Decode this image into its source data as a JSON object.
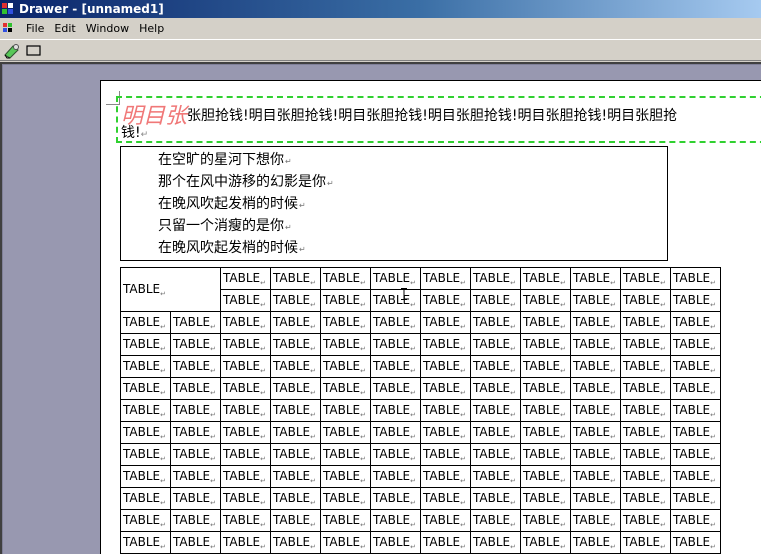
{
  "window": {
    "title": "Drawer - [unnamed1]"
  },
  "menu": [
    "File",
    "Edit",
    "Window",
    "Help"
  ],
  "toolbar": {
    "tools": [
      "draw-tool-icon",
      "rectangle-tool-icon"
    ]
  },
  "document": {
    "headline": {
      "big_text": "明目张",
      "line1_rest": "张胆抢钱!明目张胆抢钱!明目张胆抢钱!明目张胆抢钱!明目张胆抢钱!明目张胆抢",
      "line2": "钱!",
      "para_mark": "↵"
    },
    "poem": [
      "在空旷的星河下想你",
      "那个在风中游移的幻影是你",
      "在晚风吹起发梢的时候",
      "只留一个消瘦的是你",
      "在晚风吹起发梢的时候"
    ],
    "cell_mark": "↵",
    "table": {
      "header_cell": "TABLE",
      "cell_text": "TABLE",
      "header_columns": 10,
      "header_rows": 2,
      "body_rows": 11,
      "body_columns": 12
    }
  },
  "colors": {
    "headline_big": "#f07878",
    "selection_border": "#30d030",
    "title_gradient_start": "#0a246a"
  }
}
